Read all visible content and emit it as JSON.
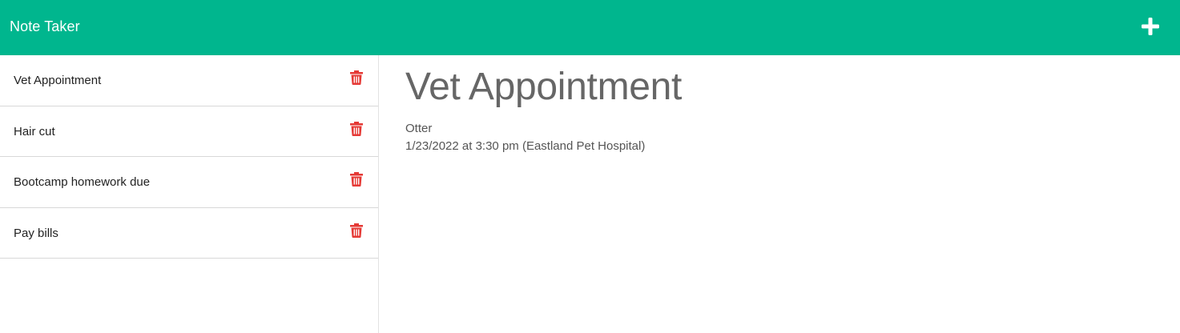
{
  "app": {
    "title": "Note Taker",
    "accent_color": "#00b68e",
    "add_icon": "plus-icon"
  },
  "notes": [
    {
      "title": "Vet Appointment",
      "delete_icon": "trash-icon"
    },
    {
      "title": "Hair cut",
      "delete_icon": "trash-icon"
    },
    {
      "title": "Bootcamp homework due",
      "delete_icon": "trash-icon"
    },
    {
      "title": "Pay bills",
      "delete_icon": "trash-icon"
    }
  ],
  "active_note": {
    "title": "Vet Appointment",
    "lines": [
      "Otter",
      "1/23/2022 at 3:30 pm (Eastland Pet Hospital)"
    ]
  },
  "colors": {
    "delete": "#e53935",
    "heading_text": "#666666"
  }
}
